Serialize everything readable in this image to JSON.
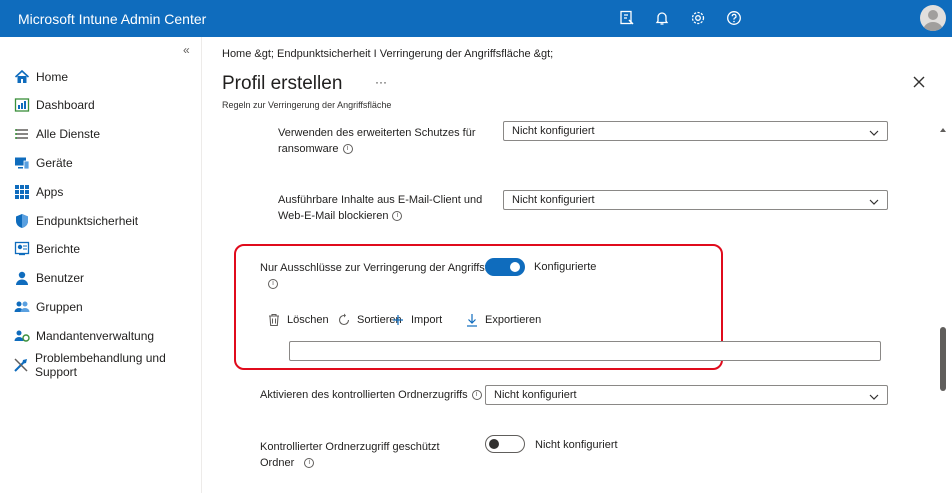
{
  "header": {
    "app_title": "Microsoft Intune Admin Center",
    "icons": [
      "feedback-icon",
      "bell-icon",
      "gear-icon",
      "help-icon",
      "avatar-icon"
    ]
  },
  "sidebar": {
    "collapse_glyph": "«",
    "items": [
      {
        "label": "Home",
        "icon": "home-icon"
      },
      {
        "label": "Dashboard",
        "icon": "dashboard-icon"
      },
      {
        "label": "Alle Dienste",
        "icon": "list-icon"
      },
      {
        "label": "Geräte",
        "icon": "devices-icon"
      },
      {
        "label": "Apps",
        "icon": "apps-grid-icon"
      },
      {
        "label": "Endpunktsicherheit",
        "icon": "shield-icon"
      },
      {
        "label": "Berichte",
        "icon": "reports-icon"
      },
      {
        "label": "Benutzer",
        "icon": "user-icon"
      },
      {
        "label": "Gruppen",
        "icon": "groups-icon"
      },
      {
        "label": "Mandantenverwaltung",
        "icon": "tenant-icon"
      },
      {
        "label": "Problembehandlung und Support",
        "icon": "troubleshoot-icon"
      }
    ]
  },
  "main": {
    "breadcrumb": "Home &gt;  Endpunktsicherheit I Verringerung der Angriffsfläche &gt;",
    "title": "Profil erstellen",
    "more": "···",
    "subtitle": "Regeln zur Verringerung der Angriffsfläche",
    "settings": {
      "ransomware_label_1": "Verwenden des erweiterten Schutzes für",
      "ransomware_label_2": "ransomware",
      "ransomware_value": "Nicht konfiguriert",
      "email_label_1": "Ausführbare Inhalte aus E-Mail-Client und",
      "email_label_2": "Web-E-Mail blockieren",
      "email_value": "Nicht konfiguriert",
      "exclusions_label": "Nur Ausschlüsse zur Verringerung der Angriffsfläche",
      "exclusions_state": "Konfigurierte",
      "toolbar": {
        "delete": "Löschen",
        "sort": "Sortieren",
        "import": "Import",
        "export": "Exportieren"
      },
      "exclusions_input_value": "",
      "cfa_label": "Aktivieren des kontrollierten Ordnerzugriffs",
      "cfa_value": "Nicht konfiguriert",
      "cfa_protected_label_1": "Kontrollierter Ordnerzugriff geschützt",
      "cfa_protected_label_2": "Ordner",
      "cfa_protected_state": "Nicht konfiguriert"
    }
  },
  "colors": {
    "brand": "#0f6cbd",
    "highlight": "#e00b1c"
  }
}
